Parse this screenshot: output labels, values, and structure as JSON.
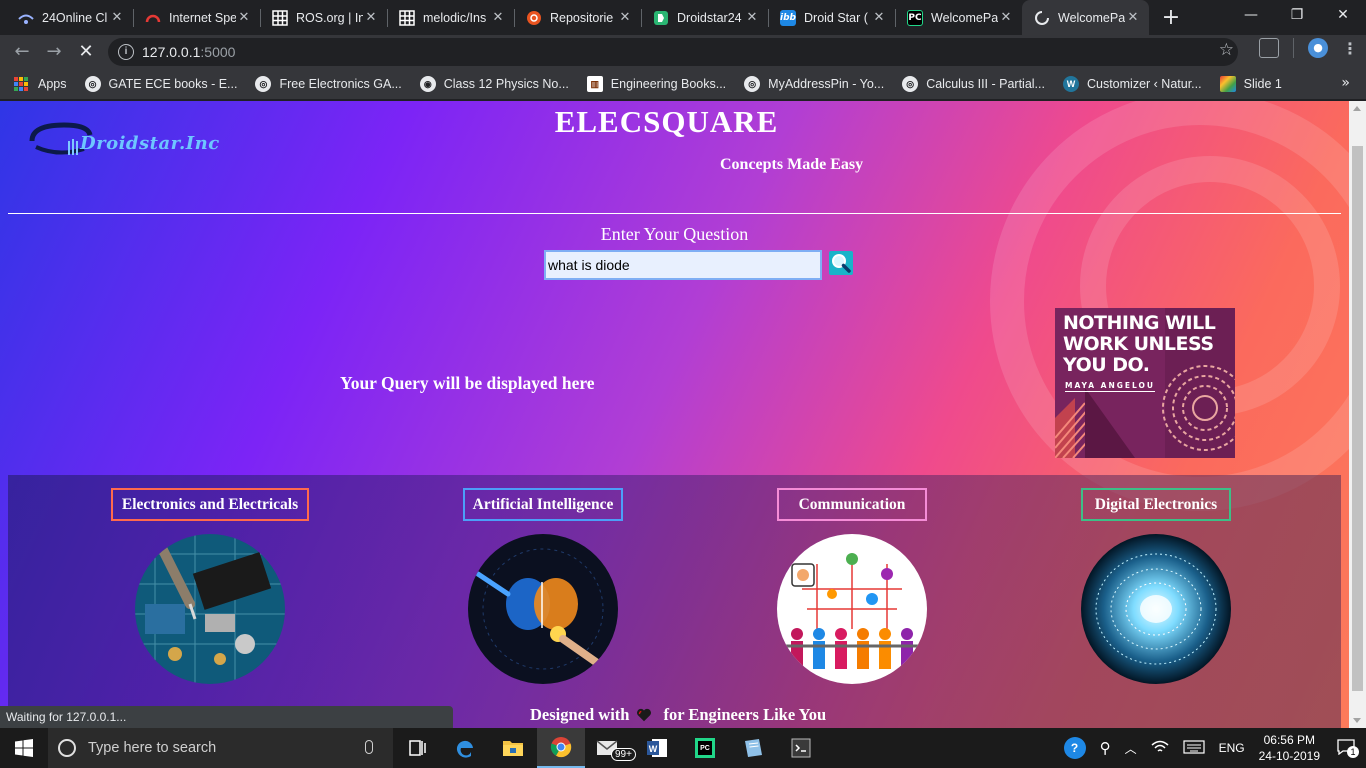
{
  "browser": {
    "tabs": [
      {
        "title": "24Online Cl",
        "icon": "wifi-icon",
        "color": "#9ab3ff"
      },
      {
        "title": "Internet Spe",
        "icon": "speedometer-icon",
        "color": "#e53935"
      },
      {
        "title": "ROS.org | In",
        "icon": "grid-icon",
        "color": "#ffffff"
      },
      {
        "title": "melodic/Ins",
        "icon": "grid-icon",
        "color": "#ffffff"
      },
      {
        "title": "Repositorie",
        "icon": "ubuntu-icon",
        "color": "#e95420"
      },
      {
        "title": "Droidstar24",
        "icon": "droidstar-icon",
        "color": "#2bb673"
      },
      {
        "title": "Droid Star (",
        "icon": "ibb-icon",
        "color": "#1e88e5"
      },
      {
        "title": "WelcomePa",
        "icon": "pycharm-icon",
        "color": "#21d789"
      },
      {
        "title": "WelcomePa",
        "icon": "loading-icon",
        "color": "#8ab4f8",
        "active": true
      }
    ],
    "new_tab_symbol": "+",
    "window_controls": {
      "minimize": "—",
      "maximize": "❐",
      "close": "✕"
    },
    "url_host": "127.0.0.1",
    "url_port": ":5000",
    "bookmarks": [
      {
        "label": "Apps",
        "icon": "apps-icon"
      },
      {
        "label": "GATE ECE books - E...",
        "icon": "globe-icon"
      },
      {
        "label": "Free Electronics GA...",
        "icon": "globe-icon"
      },
      {
        "label": "Class 12 Physics No...",
        "icon": "doc-icon"
      },
      {
        "label": "Engineering Books...",
        "icon": "library-icon"
      },
      {
        "label": "MyAddressPin - Yo...",
        "icon": "globe-icon"
      },
      {
        "label": "Calculus III - Partial...",
        "icon": "globe-icon"
      },
      {
        "label": "Customizer ‹ Natur...",
        "icon": "wordpress-icon"
      },
      {
        "label": "Slide 1",
        "icon": "slide-icon"
      }
    ],
    "bookmarks_overflow": "»",
    "status_text": "Waiting for 127.0.0.1..."
  },
  "page": {
    "logo_text": "Droidstar.Inc",
    "title": "ELECSQUARE",
    "tagline": "Concepts Made Easy",
    "question_label": "Enter Your Question",
    "question_value": "what is diode",
    "query_placeholder": "Your Query will be displayed here",
    "quote": {
      "text_line1": "NOTHING WILL",
      "text_line2": "WORK UNLESS",
      "text_line3": "YOU DO.",
      "author": "MAYA ANGELOU"
    },
    "categories": [
      {
        "label": "Electronics and Electricals",
        "border": "#ff6a4d"
      },
      {
        "label": "Artificial Intelligence",
        "border": "#4c9ff8"
      },
      {
        "label": "Communication",
        "border": "#f58cd7"
      },
      {
        "label": "Digital Electronics",
        "border": "#3dbf87"
      }
    ],
    "footer_before": "Designed with",
    "footer_after": "for Engineers Like You"
  },
  "taskbar": {
    "search_placeholder": "Type here to search",
    "mail_badge": "99+",
    "language": "ENG",
    "time": "06:56 PM",
    "date": "24-10-2019",
    "notification_count": "1"
  }
}
